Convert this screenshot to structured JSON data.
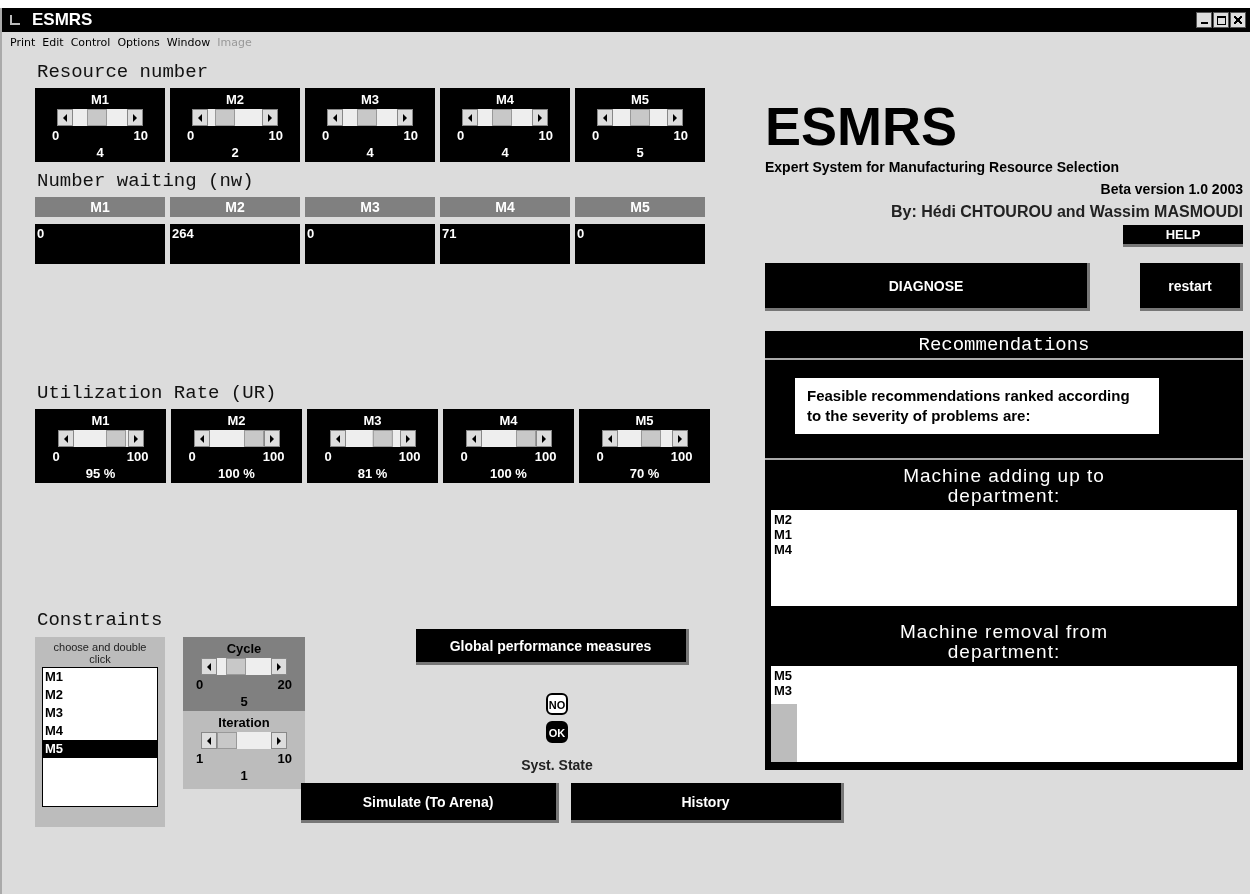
{
  "window": {
    "title": "ESMRS"
  },
  "menu": [
    {
      "label": "Print",
      "disabled": false
    },
    {
      "label": "Edit",
      "disabled": false
    },
    {
      "label": "Control",
      "disabled": false
    },
    {
      "label": "Options",
      "disabled": false
    },
    {
      "label": "Window",
      "disabled": false
    },
    {
      "label": "Image",
      "disabled": true
    }
  ],
  "resource_number": {
    "title": "Resource number",
    "sliders": [
      {
        "label": "M1",
        "min": "0",
        "max": "10",
        "reading": "4",
        "level": 0.4
      },
      {
        "label": "M2",
        "min": "0",
        "max": "10",
        "reading": "2",
        "level": 0.2
      },
      {
        "label": "M3",
        "min": "0",
        "max": "10",
        "reading": "4",
        "level": 0.4
      },
      {
        "label": "M4",
        "min": "0",
        "max": "10",
        "reading": "4",
        "level": 0.4
      },
      {
        "label": "M5",
        "min": "0",
        "max": "10",
        "reading": "5",
        "level": 0.5
      }
    ]
  },
  "number_waiting": {
    "title": "Number waiting (nw)",
    "columns": [
      {
        "header": "M1",
        "value": "0"
      },
      {
        "header": "M2",
        "value": "264"
      },
      {
        "header": "M3",
        "value": "0"
      },
      {
        "header": "M4",
        "value": "71"
      },
      {
        "header": "M5",
        "value": "0"
      }
    ]
  },
  "utilization_rate": {
    "title": "Utilization Rate (UR)",
    "sliders": [
      {
        "label": "M1",
        "min": "0",
        "max": "100",
        "reading": "95 %",
        "level": 0.95
      },
      {
        "label": "M2",
        "min": "0",
        "max": "100",
        "reading": "100 %",
        "level": 1
      },
      {
        "label": "M3",
        "min": "0",
        "max": "100",
        "reading": "81 %",
        "level": 0.81
      },
      {
        "label": "M4",
        "min": "0",
        "max": "100",
        "reading": "100 %",
        "level": 1
      },
      {
        "label": "M5",
        "min": "0",
        "max": "100",
        "reading": "70 %",
        "level": 0.7
      }
    ]
  },
  "constraints": {
    "title": "Constraints",
    "list_caption": "choose and double click",
    "items": [
      {
        "label": "M1",
        "selected": false
      },
      {
        "label": "M2",
        "selected": false
      },
      {
        "label": "M3",
        "selected": false
      },
      {
        "label": "M4",
        "selected": false
      },
      {
        "label": "M5",
        "selected": true
      }
    ],
    "cycle": {
      "label": "Cycle",
      "min": "0",
      "max": "20",
      "reading": "5",
      "level": 0.25
    },
    "iteration": {
      "label": "Iteration",
      "min": "1",
      "max": "10",
      "reading": "1",
      "level": 0
    }
  },
  "global_button": "Global performance measures",
  "system_state": {
    "indicators": [
      {
        "label": "NO",
        "selected": false
      },
      {
        "label": "OK",
        "selected": true
      }
    ],
    "label": "Syst. State"
  },
  "bottom_buttons": [
    "Simulate (To Arena)",
    "History"
  ],
  "logo": "ESMRS",
  "subtitle": "Expert System for Manufacturing Resource Selection",
  "version": "Beta version 1.0  2003",
  "authors": "By: Hédi CHTOUROU and Wassim MASMOUDI",
  "help_button": "HELP",
  "diagnose_button": "DIAGNOSE",
  "restart_button": "restart",
  "recommendations": {
    "title": "Recommendations",
    "note": "Feasible recommendations ranked according to the severity of problems are:",
    "adding": {
      "title": "Machine adding up to department:",
      "items": [
        "M2",
        "M1",
        "M4"
      ]
    },
    "removal": {
      "title": "Machine removal from department:",
      "items": [
        "M5",
        "M3"
      ]
    }
  }
}
